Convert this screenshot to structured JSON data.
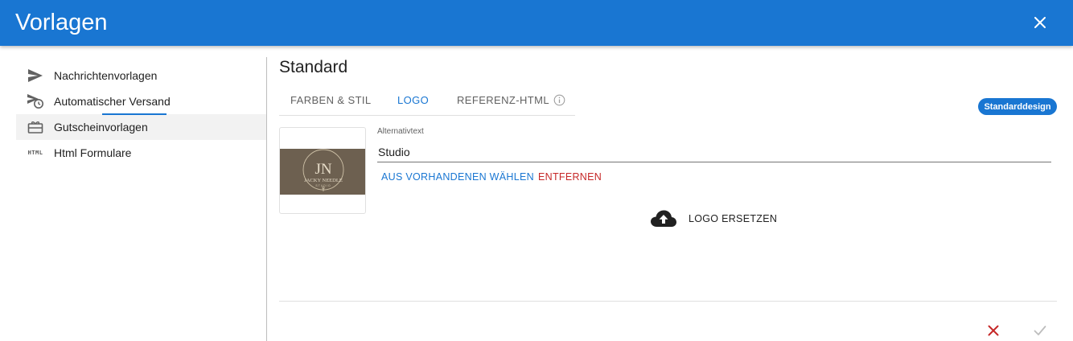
{
  "header": {
    "title": "Vorlagen",
    "close_icon": "close-icon"
  },
  "sidebar": {
    "items": [
      {
        "label": "Nachrichtenvorlagen",
        "icon": "send-icon",
        "active": false
      },
      {
        "label": "Automatischer Versand",
        "icon": "scheduled-send-icon",
        "active": false
      },
      {
        "label": "Gutscheinvorlagen",
        "icon": "gift-card-icon",
        "active": true
      },
      {
        "label": "Html Formulare",
        "icon": "html-icon",
        "icon_text": "HTML",
        "active": false
      }
    ]
  },
  "content": {
    "title": "Standard",
    "tabs": [
      {
        "label": "FARBEN & STIL",
        "active": false
      },
      {
        "label": "LOGO",
        "active": true
      },
      {
        "label": "REFERENZ-HTML",
        "active": false,
        "icon": "info-icon"
      }
    ],
    "badge": "Standarddesign",
    "logo": {
      "image_text_line1": "JACKY NEEDLE",
      "image_text_line2": "STUDIO",
      "monogram": "JN"
    },
    "alt_text": {
      "label": "Alternativtext",
      "value": "Studio"
    },
    "buttons": {
      "choose": "AUS VORHANDENEN WÄHLEN",
      "remove": "ENTFERNEN"
    },
    "upload": {
      "label": "LOGO ERSETZEN",
      "icon": "cloud-upload-icon"
    },
    "actions": {
      "cancel_icon": "close-icon",
      "confirm_icon": "check-icon"
    }
  },
  "colors": {
    "primary": "#1976d2",
    "danger": "#c62828",
    "logo_background": "#6d6050"
  }
}
